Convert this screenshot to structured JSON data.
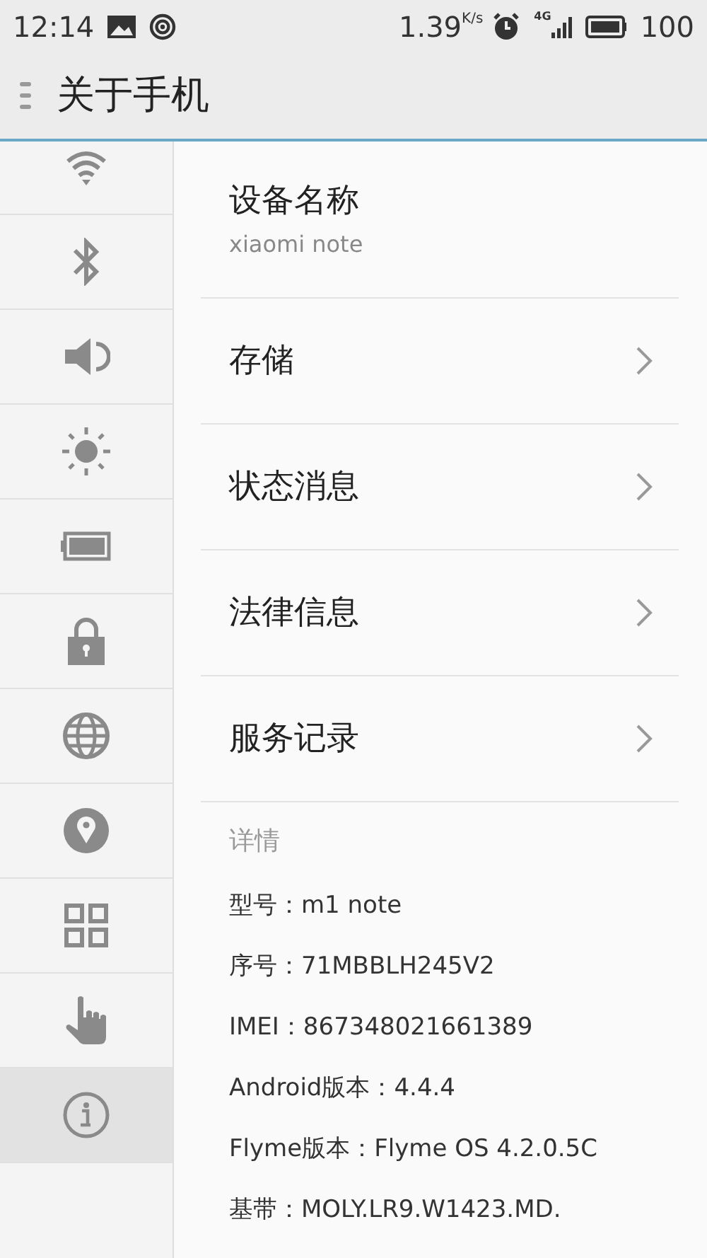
{
  "status_bar": {
    "time": "12:14",
    "speed": "1.39",
    "speed_unit": "K/s",
    "network": "4G",
    "battery": "100"
  },
  "header": {
    "title": "关于手机"
  },
  "sidebar": {
    "items": [
      {
        "selected": false
      },
      {
        "selected": false
      },
      {
        "selected": false
      },
      {
        "selected": false
      },
      {
        "selected": false
      },
      {
        "selected": false
      },
      {
        "selected": false
      },
      {
        "selected": false
      },
      {
        "selected": false
      },
      {
        "selected": false
      },
      {
        "selected": true
      }
    ]
  },
  "device": {
    "label": "设备名称",
    "value": "xiaomi note"
  },
  "menu": [
    "存储",
    "状态消息",
    "法律信息",
    "服务记录"
  ],
  "details": {
    "heading": "详情",
    "lines": [
      "型号：m1 note",
      "序号：71MBBLH245V2",
      "IMEI：867348021661389",
      "Android版本：4.4.4",
      "Flyme版本：Flyme OS 4.2.0.5C",
      "基带：MOLY.LR9.W1423.MD."
    ]
  }
}
